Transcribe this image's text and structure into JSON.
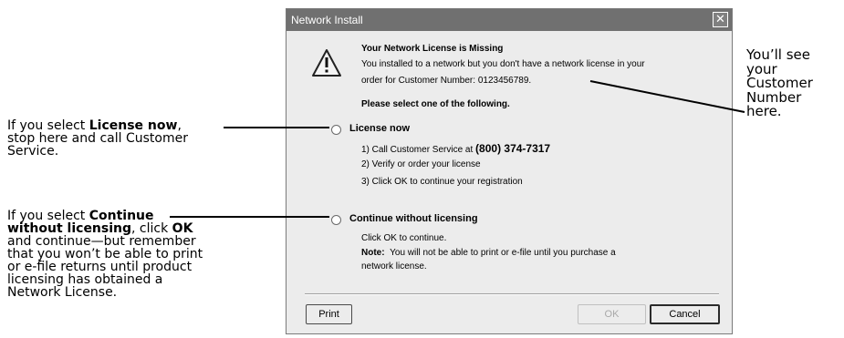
{
  "dialog": {
    "title": "Network Install",
    "close_symbol": "✕",
    "icon": "warning-icon",
    "heading": "Your Network License is Missing",
    "message_line1": "You installed to a network but you don't have a network license in your",
    "message_line2": "order for Customer Number: 0123456789.",
    "prompt": "Please select one of the following.",
    "options": [
      {
        "label": "License now",
        "steps": [
          {
            "prefix": "1) Call Customer Service at ",
            "emphasis": "(800) 374-7317"
          },
          {
            "prefix": "2) Verify or order your license",
            "emphasis": ""
          },
          {
            "prefix": "3) Click OK to continue your registration",
            "emphasis": ""
          }
        ]
      },
      {
        "label": "Continue without licensing",
        "detail_line1": "Click OK to continue.",
        "note_label": "Note:",
        "note_text": "You will not be able to print or e-file until you purchase a",
        "note_text2": "network license."
      }
    ],
    "buttons": {
      "print": "Print",
      "ok": "OK",
      "cancel": "Cancel"
    }
  },
  "annotations": {
    "license_now": {
      "pre": "If you select ",
      "bold": "License now",
      "post1": ",",
      "line2": "stop here and call Customer",
      "line3": "Service."
    },
    "continue": {
      "pre": "If you select ",
      "bold1": "Continue",
      "bold2": "without licensing",
      "mid": ", click ",
      "bold3": "OK",
      "line3": "and continue—but remember",
      "line4": "that you won’t be able to print",
      "line5": "or e-file returns until product",
      "line6": "licensing has obtained a",
      "line7": "Network License."
    },
    "customer_number": {
      "lines": [
        "You’ll see",
        "your",
        "Customer",
        "Number",
        "here."
      ]
    }
  }
}
